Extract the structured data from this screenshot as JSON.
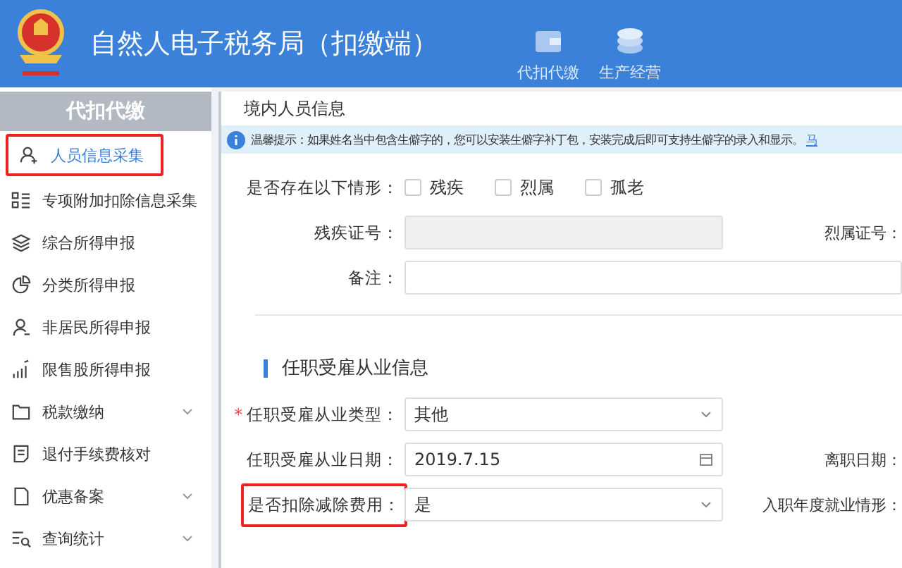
{
  "header": {
    "title": "自然人电子税务局（扣缴端）",
    "nav": [
      {
        "label": "代扣代缴"
      },
      {
        "label": "生产经营"
      }
    ]
  },
  "sidebar": {
    "heading": "代扣代缴",
    "items": [
      {
        "label": "人员信息采集",
        "selected": true,
        "has_submenu": false
      },
      {
        "label": "专项附加扣除信息采集",
        "selected": false,
        "has_submenu": false
      },
      {
        "label": "综合所得申报",
        "selected": false,
        "has_submenu": false
      },
      {
        "label": "分类所得申报",
        "selected": false,
        "has_submenu": false
      },
      {
        "label": "非居民所得申报",
        "selected": false,
        "has_submenu": false
      },
      {
        "label": "限售股所得申报",
        "selected": false,
        "has_submenu": false
      },
      {
        "label": "税款缴纳",
        "selected": false,
        "has_submenu": true
      },
      {
        "label": "退付手续费核对",
        "selected": false,
        "has_submenu": false
      },
      {
        "label": "优惠备案",
        "selected": false,
        "has_submenu": true
      },
      {
        "label": "查询统计",
        "selected": false,
        "has_submenu": true
      }
    ]
  },
  "panel": {
    "title": "境内人员信息",
    "notice": {
      "text": "温馨提示：如果姓名当中包含生僻字的，您可以安装生僻字补丁包，安装完成后即可支持生僻字的录入和显示。",
      "link": "马"
    },
    "situation": {
      "label": "是否存在以下情形：",
      "options": [
        {
          "label": "残疾",
          "checked": false
        },
        {
          "label": "烈属",
          "checked": false
        },
        {
          "label": "孤老",
          "checked": false
        }
      ]
    },
    "disability_no": {
      "label": "残疾证号：",
      "disabled": true
    },
    "martyr_no": {
      "label": "烈属证号："
    },
    "remarks": {
      "label": "备注："
    },
    "section_title": "任职受雇从业信息",
    "employment_type": {
      "label": "任职受雇从业类型：",
      "required_mark": "*",
      "value": "其他"
    },
    "employment_date": {
      "label": "任职受雇从业日期：",
      "value": "2019.7.15"
    },
    "leave_date": {
      "label": "离职日期："
    },
    "deduct_expenses": {
      "label": "是否扣除减除费用：",
      "value": "是",
      "highlighted": true
    },
    "entry_year_status": {
      "label": "入职年度就业情形："
    }
  }
}
